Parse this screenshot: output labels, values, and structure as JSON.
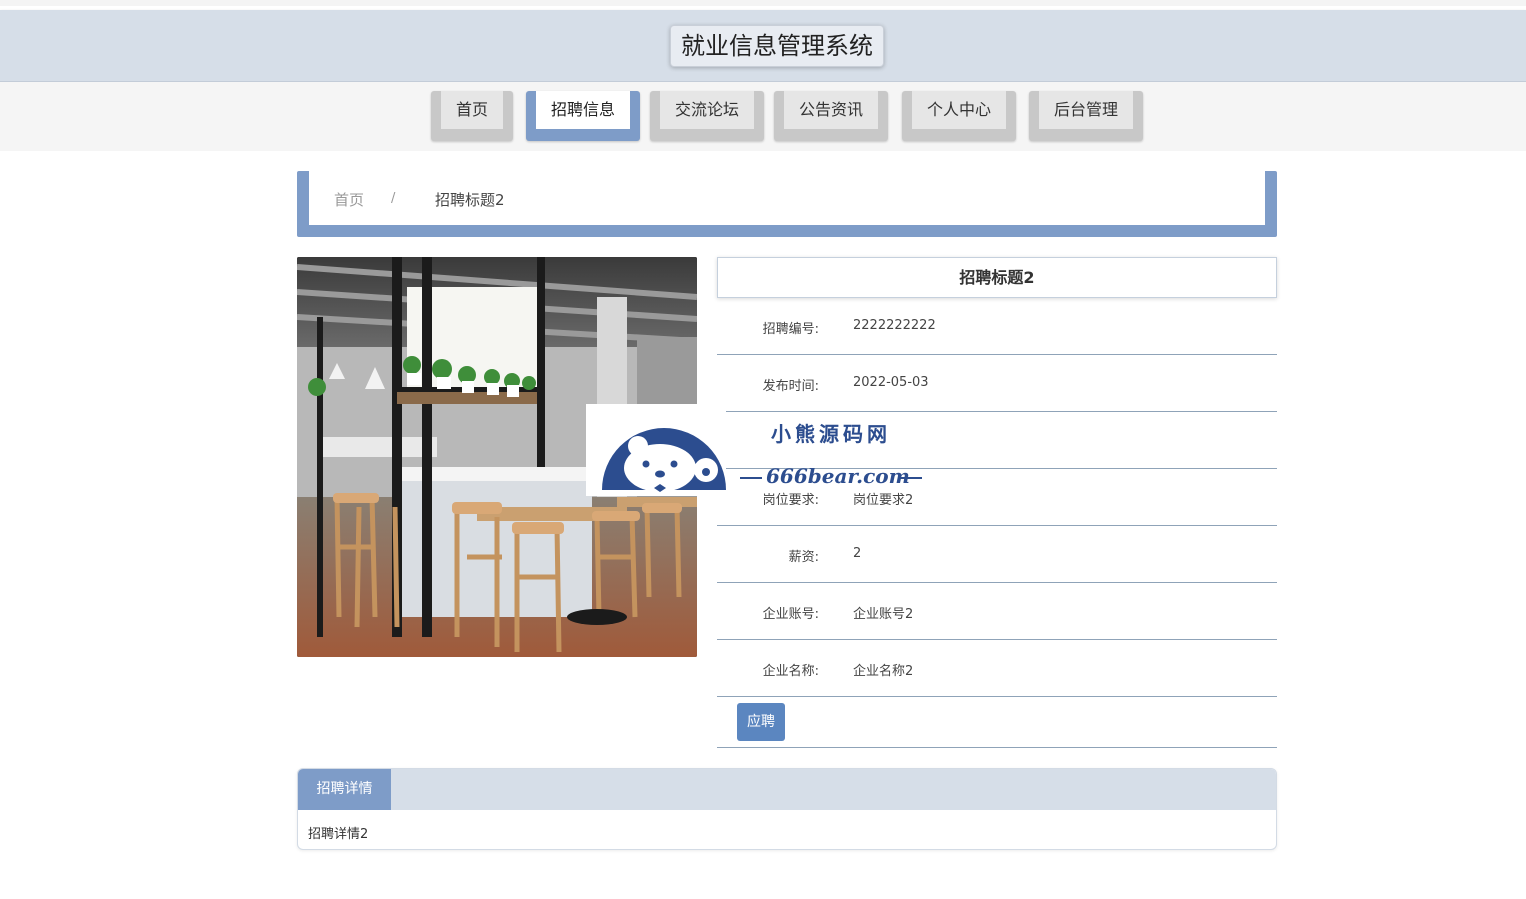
{
  "header": {
    "title": "就业信息管理系统"
  },
  "nav": {
    "items": [
      {
        "label": "首页"
      },
      {
        "label": "招聘信息"
      },
      {
        "label": "交流论坛"
      },
      {
        "label": "公告资讯"
      },
      {
        "label": "个人中心"
      },
      {
        "label": "后台管理"
      }
    ],
    "active_index": 1
  },
  "breadcrumb": {
    "home": "首页",
    "separator": "/",
    "current": "招聘标题2"
  },
  "detail": {
    "title": "招聘标题2",
    "fields": [
      {
        "label": "招聘编号:",
        "value": "2222222222"
      },
      {
        "label": "发布时间:",
        "value": "2022-05-03"
      },
      {
        "label": "",
        "value": ""
      },
      {
        "label": "岗位要求:",
        "value": "岗位要求2"
      },
      {
        "label": "薪资:",
        "value": "2"
      },
      {
        "label": "企业账号:",
        "value": "企业账号2"
      },
      {
        "label": "企业名称:",
        "value": "企业名称2"
      }
    ],
    "apply_label": "应聘"
  },
  "detail_panel": {
    "tab_label": "招聘详情",
    "content": "招聘详情2"
  },
  "watermark": {
    "line1": "小熊源码网",
    "line2": "666bear.com"
  },
  "colors": {
    "accent": "#7e9cc8",
    "header_bg": "#d6dee8",
    "button": "#5b86c0",
    "watermark": "#2c4d8f"
  }
}
